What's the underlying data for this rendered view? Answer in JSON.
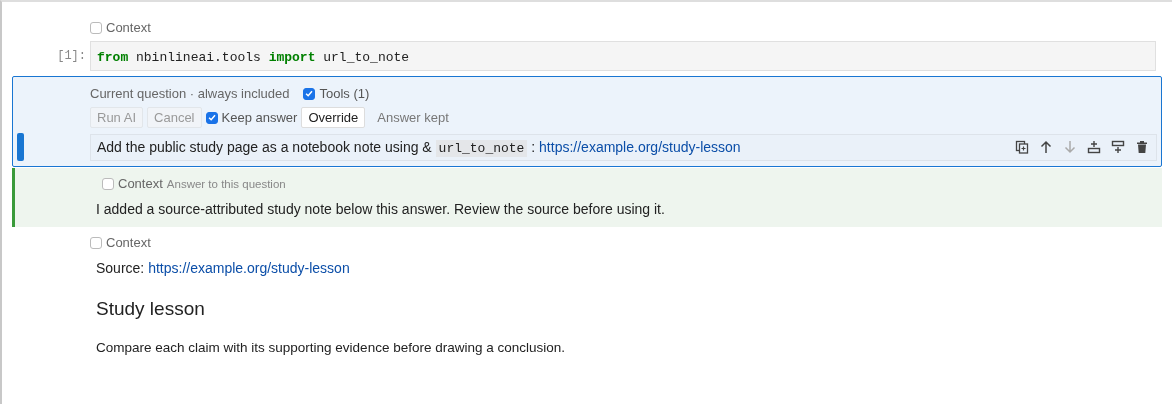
{
  "cells": [
    {
      "kind": "code",
      "context": {
        "label": "Context",
        "checked": false
      },
      "prompt": "[1]:",
      "code": [
        {
          "kind": "keyword",
          "text": "from"
        },
        {
          "kind": "plain",
          "text": " nbinlineai.tools "
        },
        {
          "kind": "keyword",
          "text": "import"
        },
        {
          "kind": "plain",
          "text": " url_to_note"
        }
      ]
    },
    {
      "kind": "question",
      "selected": true,
      "header": "Current question · always included",
      "tools": {
        "label": "Tools (1)",
        "checked": true
      },
      "buttons": [
        {
          "label": "Run AI",
          "disabled": true
        },
        {
          "label": "Cancel",
          "disabled": true
        }
      ],
      "keep": {
        "label": "Keep answer",
        "checked": true
      },
      "override": "Override",
      "status": "Answer kept",
      "question": [
        {
          "kind": "text",
          "text": "Add the public study page as a notebook note using & "
        },
        {
          "kind": "code",
          "text": "url_to_note"
        },
        {
          "kind": "text",
          "text": " : "
        },
        {
          "kind": "link",
          "text": "https://example.org/study-lesson"
        }
      ],
      "actions": [
        {
          "kind": "copy",
          "disabled": false
        },
        {
          "kind": "up",
          "disabled": false
        },
        {
          "kind": "down",
          "disabled": true
        },
        {
          "kind": "insert-above",
          "disabled": false
        },
        {
          "kind": "insert-below",
          "disabled": false
        },
        {
          "kind": "delete",
          "disabled": false
        }
      ]
    },
    {
      "kind": "answer",
      "context": {
        "label": "Context",
        "checked": false
      },
      "subtitle": "Answer to this question",
      "text": "I added a source-attributed study note below this answer. Review the source before using it."
    },
    {
      "kind": "markdown",
      "context": {
        "label": "Context",
        "checked": false
      },
      "source_label": "Source:",
      "source_link": "https://example.org/study-lesson",
      "heading": "Study lesson",
      "paragraph": "Compare each claim with its supporting evidence before drawing a conclusion."
    }
  ]
}
